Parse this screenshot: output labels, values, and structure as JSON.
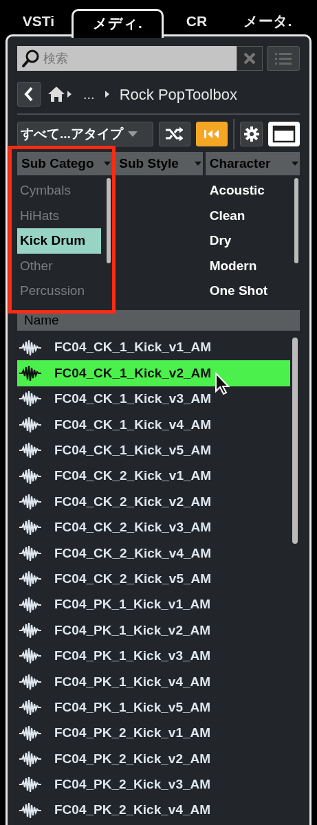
{
  "tabs": [
    {
      "label": "VSTi",
      "selected": false
    },
    {
      "label": "メディ.",
      "selected": true
    },
    {
      "label": "CR",
      "selected": false
    },
    {
      "label": "メータ.",
      "selected": false
    }
  ],
  "search": {
    "placeholder": "検索"
  },
  "breadcrumb": {
    "ellipsis": "...",
    "current": "Rock PopToolbox"
  },
  "toolbar": {
    "media_type": "すべて...アタイプ",
    "shuffle_on": false,
    "autoplay_on": true
  },
  "filter_columns": [
    {
      "header": "Sub Catego",
      "items": [
        {
          "label": "Cymbals",
          "selected": false
        },
        {
          "label": "HiHats",
          "selected": false
        },
        {
          "label": "Kick Drum",
          "selected": true
        },
        {
          "label": "Other",
          "selected": false
        },
        {
          "label": "Percussion",
          "selected": false
        }
      ]
    },
    {
      "header": "Sub Style"
    },
    {
      "header": "Character",
      "items": [
        {
          "label": "Acoustic",
          "selected": false
        },
        {
          "label": "Clean",
          "selected": false
        },
        {
          "label": "Dry",
          "selected": false
        },
        {
          "label": "Modern",
          "selected": false
        },
        {
          "label": "One Shot",
          "selected": false
        }
      ]
    }
  ],
  "results": {
    "column": "Name",
    "rows": [
      {
        "name": "FC04_CK_1_Kick_v1_AM",
        "selected": false
      },
      {
        "name": "FC04_CK_1_Kick_v2_AM",
        "selected": true
      },
      {
        "name": "FC04_CK_1_Kick_v3_AM",
        "selected": false
      },
      {
        "name": "FC04_CK_1_Kick_v4_AM",
        "selected": false
      },
      {
        "name": "FC04_CK_1_Kick_v5_AM",
        "selected": false
      },
      {
        "name": "FC04_CK_2_Kick_v1_AM",
        "selected": false
      },
      {
        "name": "FC04_CK_2_Kick_v2_AM",
        "selected": false
      },
      {
        "name": "FC04_CK_2_Kick_v3_AM",
        "selected": false
      },
      {
        "name": "FC04_CK_2_Kick_v4_AM",
        "selected": false
      },
      {
        "name": "FC04_CK_2_Kick_v5_AM",
        "selected": false
      },
      {
        "name": "FC04_PK_1_Kick_v1_AM",
        "selected": false
      },
      {
        "name": "FC04_PK_1_Kick_v2_AM",
        "selected": false
      },
      {
        "name": "FC04_PK_1_Kick_v3_AM",
        "selected": false
      },
      {
        "name": "FC04_PK_1_Kick_v4_AM",
        "selected": false
      },
      {
        "name": "FC04_PK_1_Kick_v5_AM",
        "selected": false
      },
      {
        "name": "FC04_PK_2_Kick_v1_AM",
        "selected": false
      },
      {
        "name": "FC04_PK_2_Kick_v2_AM",
        "selected": false
      },
      {
        "name": "FC04_PK_2_Kick_v3_AM",
        "selected": false
      },
      {
        "name": "FC04_PK_2_Kick_v4_AM",
        "selected": false
      }
    ]
  }
}
